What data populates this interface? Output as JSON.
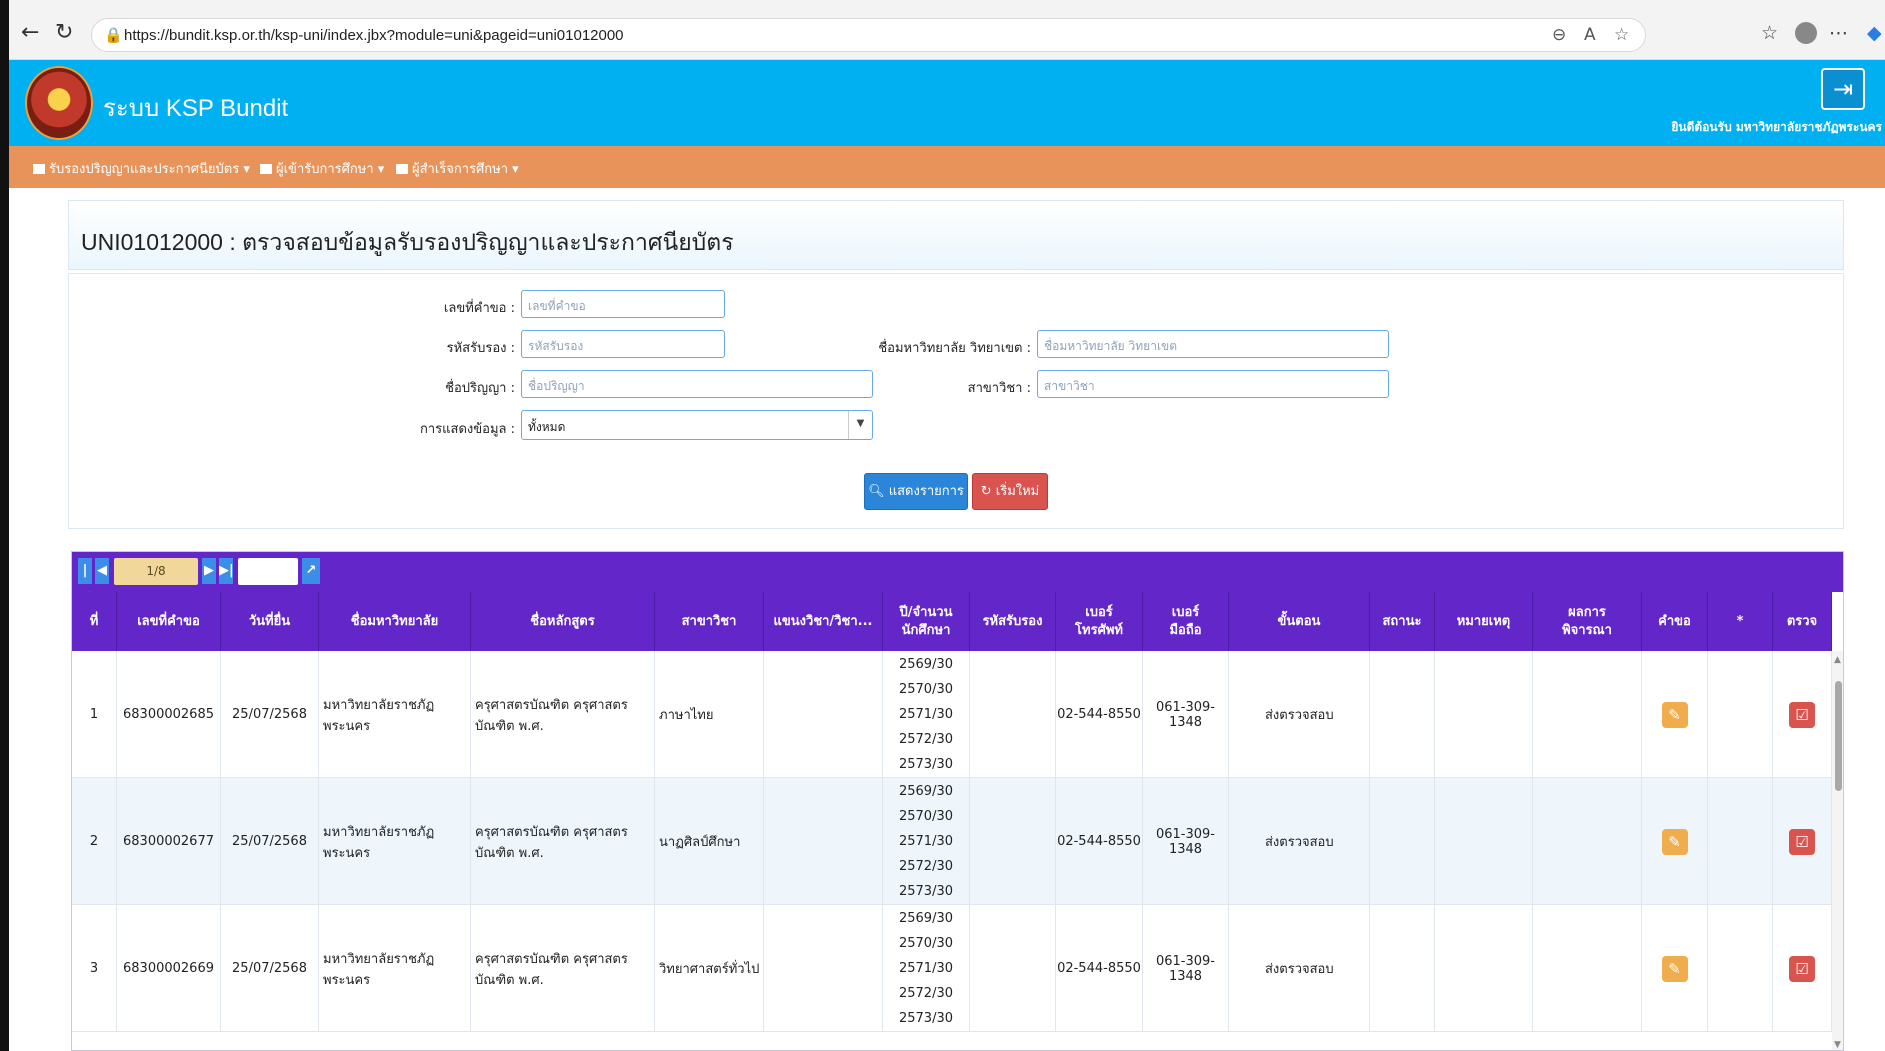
{
  "browser": {
    "url": "https://bundit.ksp.or.th/ksp-uni/index.jbx?module=uni&pageid=uni01012000",
    "back_icon": "arrow-left-icon",
    "refresh_icon": "refresh-icon"
  },
  "app": {
    "title": "ระบบ KSP Bundit",
    "welcome": "ยินดีต้อนรับ มหาวิทยาลัยราชภัฏพระนคร",
    "brand_color": "#00b0f0",
    "menu_color": "#e8935a",
    "grid_header_color": "#6326c9"
  },
  "menu": {
    "items": [
      {
        "label": "รับรองปริญญาและประกาศนียบัตร"
      },
      {
        "label": "ผู้เข้ารับการศึกษา"
      },
      {
        "label": "ผู้สำเร็จการศึกษา"
      }
    ]
  },
  "page": {
    "title": "UNI01012000 : ตรวจสอบข้อมูลรับรองปริญญาและประกาศนียบัตร"
  },
  "form": {
    "request_no": {
      "label": "เลขที่คำขอ :",
      "placeholder": "เลขที่คำขอ"
    },
    "cert_code": {
      "label": "รหัสรับรอง :",
      "placeholder": "รหัสรับรอง"
    },
    "university": {
      "label": "ชื่อมหาวิทยาลัย วิทยาเขต :",
      "placeholder": "ชื่อมหาวิทยาลัย วิทยาเขต"
    },
    "degree": {
      "label": "ชื่อปริญญา :",
      "placeholder": "ชื่อปริญญา"
    },
    "major": {
      "label": "สาขาวิชา :",
      "placeholder": "สาขาวิชา"
    },
    "display": {
      "label": "การแสดงข้อมูล :",
      "value": "ทั้งหมด"
    },
    "show_button": "แสดงรายการ",
    "reset_button": "เริ่มใหม่"
  },
  "pager": {
    "page_info": "1/8"
  },
  "table": {
    "columns": [
      "ที่",
      "เลขที่คำขอ",
      "วันที่ยื่น",
      "ชื่อมหาวิทยาลัย",
      "ชื่อหลักสูตร",
      "สาขาวิชา",
      "แขนงวิชา/วิชา...",
      "ปี/จำนวน\nนักศึกษา",
      "รหัสรับรอง",
      "เบอร์\nโทรศัพท์",
      "เบอร์\nมือถือ",
      "ขั้นตอน",
      "สถานะ",
      "หมายเหตุ",
      "ผลการ\nพิจารณา",
      "คำขอ",
      "*",
      "ตรวจ"
    ],
    "rows": [
      {
        "no": "1",
        "request_no": "68300002685",
        "date": "25/07/2568",
        "university": "มหาวิทยาลัยราชภัฏพระนคร",
        "course": "ครุศาสตรบัณฑิต ครุศาสตรบัณฑิต พ.ศ.",
        "major": "ภาษาไทย",
        "branch": "",
        "years": [
          "2569/30",
          "2570/30",
          "2571/30",
          "2572/30",
          "2573/30"
        ],
        "cert_code": "",
        "phone": "02-544-8550",
        "mobile": "061-309-1348",
        "step": "ส่งตรวจสอบ",
        "status": "",
        "note": "",
        "result": ""
      },
      {
        "no": "2",
        "request_no": "68300002677",
        "date": "25/07/2568",
        "university": "มหาวิทยาลัยราชภัฏพระนคร",
        "course": "ครุศาสตรบัณฑิต ครุศาสตรบัณฑิต พ.ศ.",
        "major": "นาฏศิลป์ศึกษา",
        "branch": "",
        "years": [
          "2569/30",
          "2570/30",
          "2571/30",
          "2572/30",
          "2573/30"
        ],
        "cert_code": "",
        "phone": "02-544-8550",
        "mobile": "061-309-1348",
        "step": "ส่งตรวจสอบ",
        "status": "",
        "note": "",
        "result": ""
      },
      {
        "no": "3",
        "request_no": "68300002669",
        "date": "25/07/2568",
        "university": "มหาวิทยาลัยราชภัฏพระนคร",
        "course": "ครุศาสตรบัณฑิต ครุศาสตรบัณฑิต พ.ศ.",
        "major": "วิทยาศาสตร์ทั่วไป",
        "branch": "",
        "years": [
          "2569/30",
          "2570/30",
          "2571/30",
          "2572/30",
          "2573/30"
        ],
        "cert_code": "",
        "phone": "02-544-8550",
        "mobile": "061-309-1348",
        "step": "ส่งตรวจสอบ",
        "status": "",
        "note": "",
        "result": ""
      }
    ]
  }
}
